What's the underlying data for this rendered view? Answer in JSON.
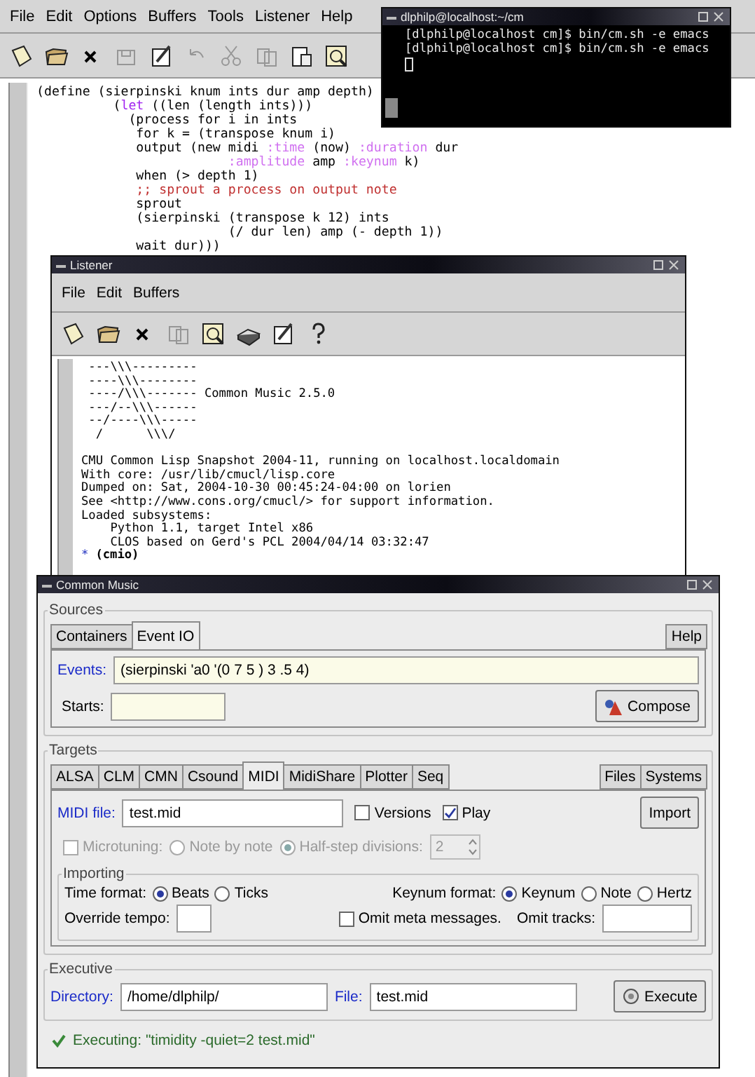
{
  "editor": {
    "menu": [
      "File",
      "Edit",
      "Options",
      "Buffers",
      "Tools",
      "Listener",
      "Help"
    ],
    "toolbar": [
      {
        "kind": "new",
        "disabled": false
      },
      {
        "kind": "open",
        "disabled": false
      },
      {
        "kind": "close",
        "disabled": false
      },
      {
        "kind": "save",
        "disabled": true
      },
      {
        "kind": "edit",
        "disabled": false
      },
      {
        "kind": "undo",
        "disabled": true
      },
      {
        "kind": "cut",
        "disabled": true
      },
      {
        "kind": "copy",
        "disabled": true
      },
      {
        "kind": "paste",
        "disabled": false
      },
      {
        "kind": "search",
        "disabled": false
      }
    ],
    "code": [
      [
        {
          "text": "(define (sierpinski knum ints dur amp depth)",
          "kind": "plain"
        }
      ],
      [
        {
          "text": "          (",
          "kind": "plain"
        },
        {
          "text": "let",
          "kind": "special"
        },
        {
          "text": " ((len (length ints)))",
          "kind": "plain"
        }
      ],
      [
        {
          "text": "            (process for i in ints",
          "kind": "plain"
        }
      ],
      [
        {
          "text": "             for k = (transpose knum i)",
          "kind": "plain"
        }
      ],
      [
        {
          "text": "             output (new midi ",
          "kind": "plain"
        },
        {
          "text": ":time",
          "kind": "keyword"
        },
        {
          "text": " (now) ",
          "kind": "plain"
        },
        {
          "text": ":duration",
          "kind": "keyword"
        },
        {
          "text": " dur",
          "kind": "plain"
        }
      ],
      [
        {
          "text": "                         :amplitude",
          "kind": "keyword"
        },
        {
          "text": " amp ",
          "kind": "plain"
        },
        {
          "text": ":keynum",
          "kind": "keyword"
        },
        {
          "text": " k)",
          "kind": "plain"
        }
      ],
      [
        {
          "text": "             when (> depth 1)",
          "kind": "plain"
        }
      ],
      [
        {
          "text": "             ;; sprout a process on output note",
          "kind": "comment"
        }
      ],
      [
        {
          "text": "             sprout",
          "kind": "plain"
        }
      ],
      [
        {
          "text": "             (sierpinski (transpose k 12) ints",
          "kind": "plain"
        }
      ],
      [
        {
          "text": "                         (/ dur len) amp (- depth 1))",
          "kind": "plain"
        }
      ],
      [
        {
          "text": "             wait dur)))",
          "kind": "plain"
        }
      ]
    ]
  },
  "terminal": {
    "title": "dlphilp@localhost:~/cm",
    "lines": [
      "[dlphilp@localhost cm]$ bin/cm.sh -e emacs",
      "[dlphilp@localhost cm]$ bin/cm.sh -e emacs"
    ]
  },
  "listener": {
    "title": "Listener",
    "menu": [
      "File",
      "Edit",
      "Buffers"
    ],
    "toolbar": [
      {
        "kind": "new",
        "disabled": false
      },
      {
        "kind": "open",
        "disabled": false
      },
      {
        "kind": "close",
        "disabled": false
      },
      {
        "kind": "copy",
        "disabled": true
      },
      {
        "kind": "search",
        "disabled": false
      },
      {
        "kind": "print",
        "disabled": false
      },
      {
        "kind": "edit",
        "disabled": false
      },
      {
        "kind": "help",
        "disabled": false
      }
    ],
    "banner": [
      " ---\\\\\\---------",
      " ----\\\\\\--------",
      " ----/\\\\\\------- Common Music 2.5.0",
      " ---/--\\\\\\------",
      " --/----\\\\\\-----",
      "  /      \\\\\\/"
    ],
    "output": [
      "CMU Common Lisp Snapshot 2004-11, running on localhost.localdomain",
      "With core: /usr/lib/cmucl/lisp.core",
      "Dumped on: Sat, 2004-10-30 00:45:24-04:00 on lorien",
      "See <http://www.cons.org/cmucl/> for support information.",
      "Loaded subsystems:",
      "    Python 1.1, target Intel x86",
      "    CLOS based on Gerd's PCL 2004/04/14 03:32:47"
    ],
    "prompt": {
      "marker": "*",
      "input": "(cmio)"
    }
  },
  "common_music": {
    "title": "Common Music",
    "sources": {
      "title": "Sources",
      "tabs": [
        {
          "label": "Containers",
          "selected": false
        },
        {
          "label": "Event IO",
          "selected": true
        }
      ],
      "help": "Help",
      "events_label": "Events:",
      "events_value": "(sierpinski 'a0 '(0 7 5 ) 3 .5 4)",
      "starts_label": "Starts:",
      "compose": "Compose"
    },
    "targets": {
      "title": "Targets",
      "tabs": [
        {
          "label": "ALSA",
          "selected": false
        },
        {
          "label": "CLM",
          "selected": false
        },
        {
          "label": "CMN",
          "selected": false
        },
        {
          "label": "Csound",
          "selected": false
        },
        {
          "label": "MIDI",
          "selected": true
        },
        {
          "label": "MidiShare",
          "selected": false
        },
        {
          "label": "Plotter",
          "selected": false
        },
        {
          "label": "Seq",
          "selected": false
        }
      ],
      "side_tabs": [
        {
          "label": "Files",
          "selected": false
        },
        {
          "label": "Systems",
          "selected": false
        }
      ],
      "midi_file_label": "MIDI file:",
      "midi_file": "test.mid",
      "options": [
        {
          "label": "Versions",
          "checked": false
        },
        {
          "label": "Play",
          "checked": true
        }
      ],
      "import": "Import",
      "microtuning": {
        "disabled": true,
        "label": "Microtuning:",
        "checked": false,
        "modes": [
          {
            "label": "Note by note",
            "selected": false
          },
          {
            "label": "Half-step divisions:",
            "selected": true
          }
        ],
        "divisions": "2"
      },
      "importing": {
        "title": "Importing",
        "time_label": "Time format:",
        "time_formats": [
          {
            "label": "Beats",
            "selected": true
          },
          {
            "label": "Ticks",
            "selected": false
          }
        ],
        "keynum_label": "Keynum format:",
        "keynum_formats": [
          {
            "label": "Keynum",
            "selected": true
          },
          {
            "label": "Note",
            "selected": false
          },
          {
            "label": "Hertz",
            "selected": false
          }
        ],
        "tempo_label": "Override tempo:",
        "omit_meta": {
          "label": "Omit meta messages.",
          "checked": false
        },
        "omit_tracks_label": "Omit tracks:"
      }
    },
    "executive": {
      "title": "Executive",
      "directory_label": "Directory:",
      "directory": "/home/dlphilp/",
      "file_label": "File:",
      "file": "test.mid",
      "execute": "Execute"
    },
    "status": "Executing: \"timidity -quiet=2 test.mid\""
  }
}
